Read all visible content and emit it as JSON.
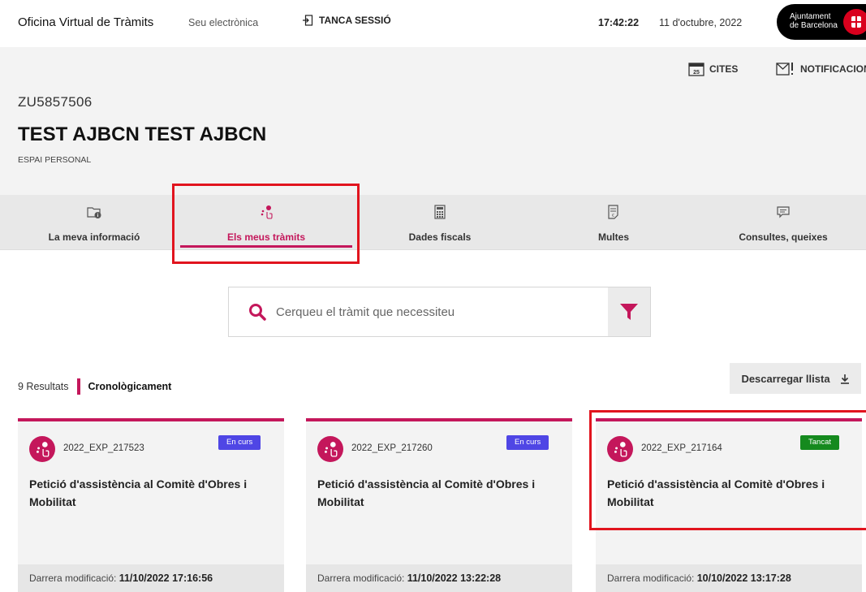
{
  "topbar": {
    "app_title": "Oficina Virtual de Tràmits",
    "seu_link": "Seu electrònica",
    "logout_label": "TANCA SESSIÓ",
    "time": "17:42:22",
    "date": "11 d'octubre, 2022",
    "logo_line1": "Ajuntament",
    "logo_line2": "de Barcelona"
  },
  "quick_links": [
    {
      "label": "CITES",
      "icon": "calendar-icon",
      "icon_text": "25"
    },
    {
      "label": "NOTIFICACIONS",
      "icon": "notification-icon"
    }
  ],
  "user": {
    "id": "ZU5857506",
    "name": "TEST AJBCN TEST AJBCN",
    "space": "ESPAI PERSONAL"
  },
  "tabs": [
    {
      "label": "La meva informació",
      "icon": "folder-info-icon",
      "active": false
    },
    {
      "label": "Els meus tràmits",
      "icon": "procedures-icon",
      "active": true
    },
    {
      "label": "Dades fiscals",
      "icon": "calculator-icon",
      "active": false
    },
    {
      "label": "Multes",
      "icon": "fine-document-icon",
      "active": false
    },
    {
      "label": "Consultes, queixes",
      "icon": "chat-bubble-icon",
      "active": false
    }
  ],
  "search": {
    "placeholder": "Cerqueu el tràmit que necessiteu",
    "value": ""
  },
  "results": {
    "count": "9 Resultats",
    "order": "Cronològicament"
  },
  "download_label": "Descarregar llista",
  "cards": [
    {
      "code": "2022_EXP_217523",
      "status": "En curs",
      "title": "Petició d'assistència al Comitè d'Obres i Mobilitat",
      "modified_label": "Darrera modificació:",
      "modified_value": "11/10/2022 17:16:56"
    },
    {
      "code": "2022_EXP_217260",
      "status": "En curs",
      "title": "Petició d'assistència al Comitè d'Obres i Mobilitat",
      "modified_label": "Darrera modificació:",
      "modified_value": "11/10/2022 13:22:28"
    },
    {
      "code": "2022_EXP_217164",
      "status": "Tancat",
      "title": "Petició d'assistència al Comitè d'Obres i Mobilitat",
      "modified_label": "Darrera modificació:",
      "modified_value": "10/10/2022 13:17:28"
    }
  ],
  "colors": {
    "accent": "#c4175b",
    "status_in_progress": "#4f46e5",
    "status_closed": "#158a1e",
    "highlight": "#e1141e"
  }
}
